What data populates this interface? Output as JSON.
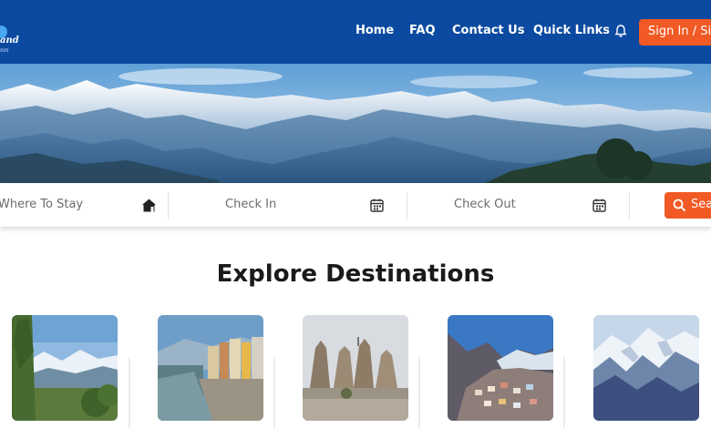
{
  "header": {
    "logo_text": "and",
    "logo_sub": "nm",
    "nav": [
      "Home",
      "FAQ",
      "Contact Us",
      "Quick Links"
    ],
    "signin_label": "Sign In / Sign Up"
  },
  "search": {
    "where_placeholder": "Where To Stay",
    "checkin_placeholder": "Check In",
    "checkout_placeholder": "Check Out",
    "button_label": "Search"
  },
  "section": {
    "title": "Explore Destinations"
  },
  "colors": {
    "header_bg": "#0b4aa0",
    "accent": "#f15a24"
  },
  "icons": [
    "bell-icon",
    "home-icon",
    "calendar-icon",
    "search-icon"
  ]
}
